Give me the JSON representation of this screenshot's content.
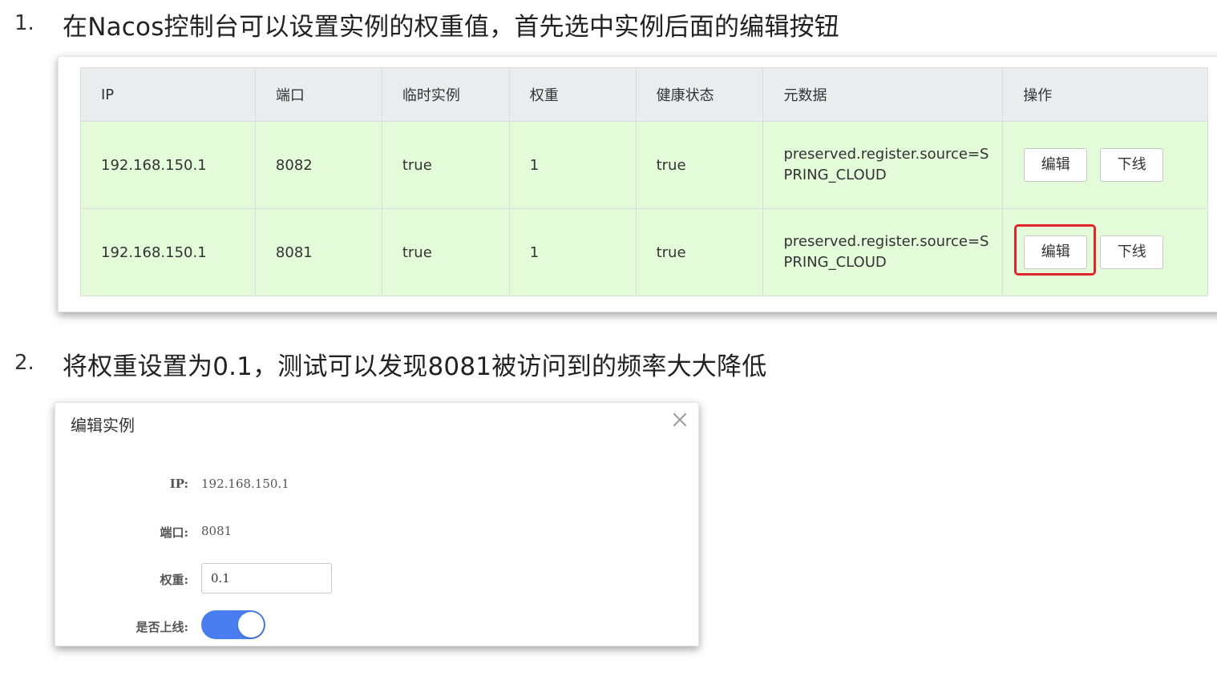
{
  "step1": {
    "num": "1.",
    "text": "在Nacos控制台可以设置实例的权重值，首先选中实例后面的编辑按钮"
  },
  "table": {
    "headers": [
      "IP",
      "端口",
      "临时实例",
      "权重",
      "健康状态",
      "元数据",
      "操作"
    ],
    "rows": [
      {
        "ip": "192.168.150.1",
        "port": "8082",
        "ephemeral": "true",
        "weight": "1",
        "healthy": "true",
        "metadata_line1": "preserved.register.source=S",
        "metadata_line2": "PRING_CLOUD",
        "edit_label": "编辑",
        "offline_label": "下线"
      },
      {
        "ip": "192.168.150.1",
        "port": "8081",
        "ephemeral": "true",
        "weight": "1",
        "healthy": "true",
        "metadata_line1": "preserved.register.source=S",
        "metadata_line2": "PRING_CLOUD",
        "edit_label": "编辑",
        "offline_label": "下线"
      }
    ]
  },
  "step2": {
    "num": "2.",
    "text": "将权重设置为0.1，测试可以发现8081被访问到的频率大大降低"
  },
  "dialog": {
    "title": "编辑实例",
    "ip_label": "IP:",
    "ip_value": "192.168.150.1",
    "port_label": "端口:",
    "port_value": "8081",
    "weight_label": "权重:",
    "weight_value": "0.1",
    "online_label": "是否上线:",
    "online": true
  },
  "colors": {
    "row_bg": "#e3fbd9",
    "header_bg": "#ebecee",
    "highlight": "#e0252b",
    "toggle_on": "#4a7ef0"
  }
}
